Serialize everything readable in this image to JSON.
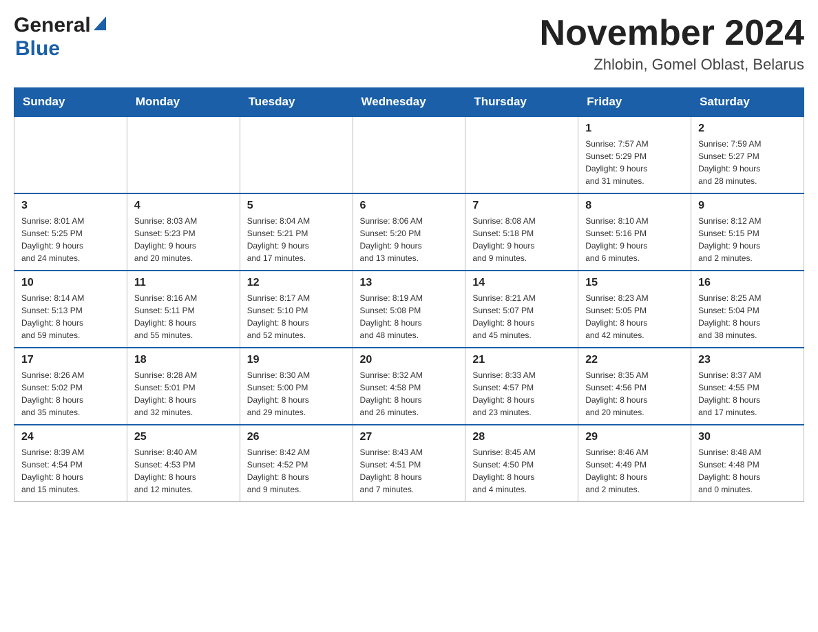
{
  "header": {
    "logo_general": "General",
    "logo_blue": "Blue",
    "title": "November 2024",
    "location": "Zhlobin, Gomel Oblast, Belarus"
  },
  "days_of_week": [
    "Sunday",
    "Monday",
    "Tuesday",
    "Wednesday",
    "Thursday",
    "Friday",
    "Saturday"
  ],
  "weeks": [
    [
      {
        "day": "",
        "info": ""
      },
      {
        "day": "",
        "info": ""
      },
      {
        "day": "",
        "info": ""
      },
      {
        "day": "",
        "info": ""
      },
      {
        "day": "",
        "info": ""
      },
      {
        "day": "1",
        "info": "Sunrise: 7:57 AM\nSunset: 5:29 PM\nDaylight: 9 hours\nand 31 minutes."
      },
      {
        "day": "2",
        "info": "Sunrise: 7:59 AM\nSunset: 5:27 PM\nDaylight: 9 hours\nand 28 minutes."
      }
    ],
    [
      {
        "day": "3",
        "info": "Sunrise: 8:01 AM\nSunset: 5:25 PM\nDaylight: 9 hours\nand 24 minutes."
      },
      {
        "day": "4",
        "info": "Sunrise: 8:03 AM\nSunset: 5:23 PM\nDaylight: 9 hours\nand 20 minutes."
      },
      {
        "day": "5",
        "info": "Sunrise: 8:04 AM\nSunset: 5:21 PM\nDaylight: 9 hours\nand 17 minutes."
      },
      {
        "day": "6",
        "info": "Sunrise: 8:06 AM\nSunset: 5:20 PM\nDaylight: 9 hours\nand 13 minutes."
      },
      {
        "day": "7",
        "info": "Sunrise: 8:08 AM\nSunset: 5:18 PM\nDaylight: 9 hours\nand 9 minutes."
      },
      {
        "day": "8",
        "info": "Sunrise: 8:10 AM\nSunset: 5:16 PM\nDaylight: 9 hours\nand 6 minutes."
      },
      {
        "day": "9",
        "info": "Sunrise: 8:12 AM\nSunset: 5:15 PM\nDaylight: 9 hours\nand 2 minutes."
      }
    ],
    [
      {
        "day": "10",
        "info": "Sunrise: 8:14 AM\nSunset: 5:13 PM\nDaylight: 8 hours\nand 59 minutes."
      },
      {
        "day": "11",
        "info": "Sunrise: 8:16 AM\nSunset: 5:11 PM\nDaylight: 8 hours\nand 55 minutes."
      },
      {
        "day": "12",
        "info": "Sunrise: 8:17 AM\nSunset: 5:10 PM\nDaylight: 8 hours\nand 52 minutes."
      },
      {
        "day": "13",
        "info": "Sunrise: 8:19 AM\nSunset: 5:08 PM\nDaylight: 8 hours\nand 48 minutes."
      },
      {
        "day": "14",
        "info": "Sunrise: 8:21 AM\nSunset: 5:07 PM\nDaylight: 8 hours\nand 45 minutes."
      },
      {
        "day": "15",
        "info": "Sunrise: 8:23 AM\nSunset: 5:05 PM\nDaylight: 8 hours\nand 42 minutes."
      },
      {
        "day": "16",
        "info": "Sunrise: 8:25 AM\nSunset: 5:04 PM\nDaylight: 8 hours\nand 38 minutes."
      }
    ],
    [
      {
        "day": "17",
        "info": "Sunrise: 8:26 AM\nSunset: 5:02 PM\nDaylight: 8 hours\nand 35 minutes."
      },
      {
        "day": "18",
        "info": "Sunrise: 8:28 AM\nSunset: 5:01 PM\nDaylight: 8 hours\nand 32 minutes."
      },
      {
        "day": "19",
        "info": "Sunrise: 8:30 AM\nSunset: 5:00 PM\nDaylight: 8 hours\nand 29 minutes."
      },
      {
        "day": "20",
        "info": "Sunrise: 8:32 AM\nSunset: 4:58 PM\nDaylight: 8 hours\nand 26 minutes."
      },
      {
        "day": "21",
        "info": "Sunrise: 8:33 AM\nSunset: 4:57 PM\nDaylight: 8 hours\nand 23 minutes."
      },
      {
        "day": "22",
        "info": "Sunrise: 8:35 AM\nSunset: 4:56 PM\nDaylight: 8 hours\nand 20 minutes."
      },
      {
        "day": "23",
        "info": "Sunrise: 8:37 AM\nSunset: 4:55 PM\nDaylight: 8 hours\nand 17 minutes."
      }
    ],
    [
      {
        "day": "24",
        "info": "Sunrise: 8:39 AM\nSunset: 4:54 PM\nDaylight: 8 hours\nand 15 minutes."
      },
      {
        "day": "25",
        "info": "Sunrise: 8:40 AM\nSunset: 4:53 PM\nDaylight: 8 hours\nand 12 minutes."
      },
      {
        "day": "26",
        "info": "Sunrise: 8:42 AM\nSunset: 4:52 PM\nDaylight: 8 hours\nand 9 minutes."
      },
      {
        "day": "27",
        "info": "Sunrise: 8:43 AM\nSunset: 4:51 PM\nDaylight: 8 hours\nand 7 minutes."
      },
      {
        "day": "28",
        "info": "Sunrise: 8:45 AM\nSunset: 4:50 PM\nDaylight: 8 hours\nand 4 minutes."
      },
      {
        "day": "29",
        "info": "Sunrise: 8:46 AM\nSunset: 4:49 PM\nDaylight: 8 hours\nand 2 minutes."
      },
      {
        "day": "30",
        "info": "Sunrise: 8:48 AM\nSunset: 4:48 PM\nDaylight: 8 hours\nand 0 minutes."
      }
    ]
  ]
}
